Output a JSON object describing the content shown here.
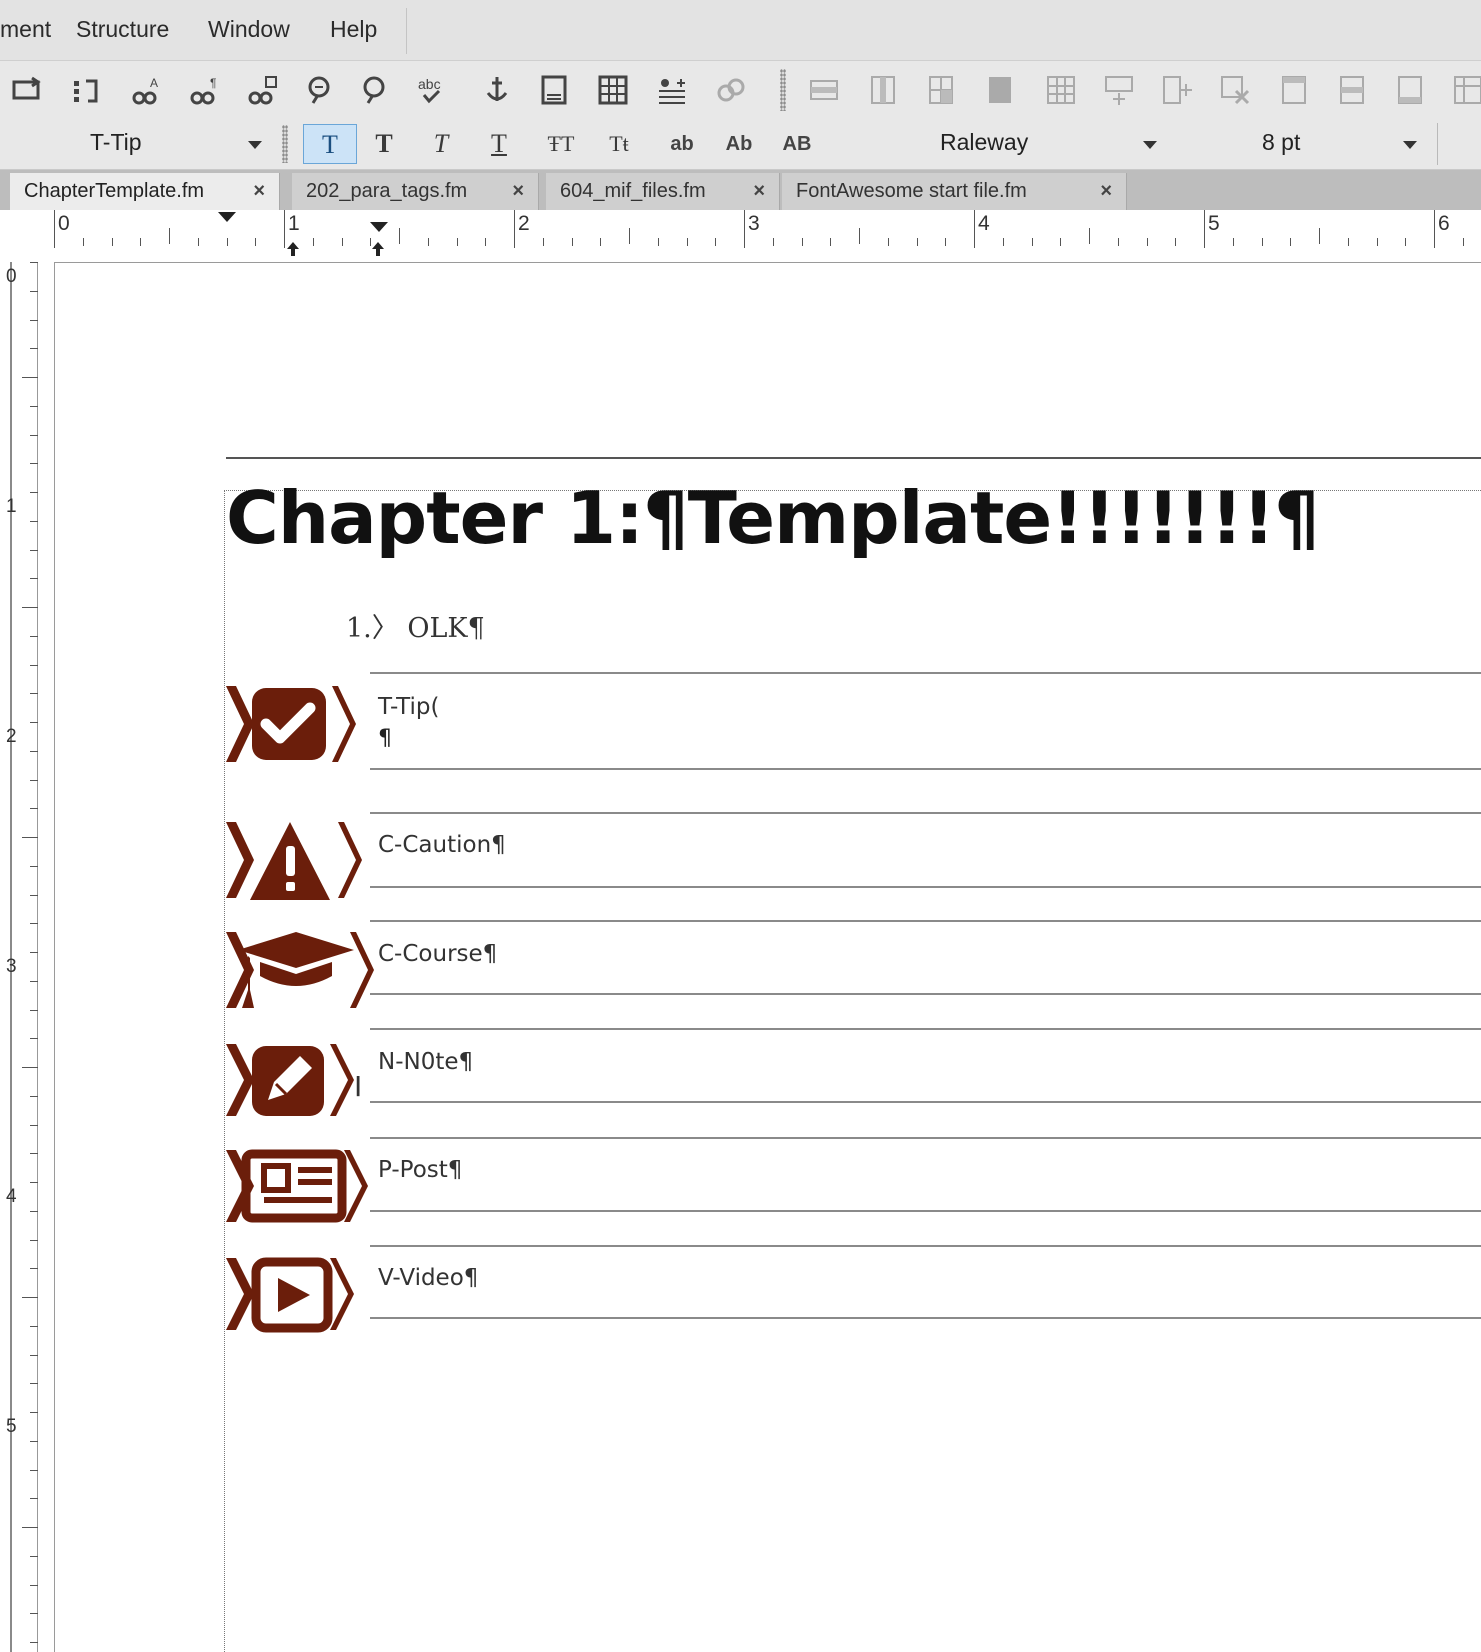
{
  "menu": {
    "items": [
      {
        "label": "ment"
      },
      {
        "label": "Structure"
      },
      {
        "label": "Window"
      },
      {
        "label": "Help"
      }
    ]
  },
  "format_toolbar": {
    "paragraph_tag": "T-Tip",
    "char_buttons": [
      "T",
      "T",
      "T",
      "T",
      "ŦT",
      "Tŧ",
      "ab",
      "Ab",
      "AB"
    ],
    "font_family": "Raleway",
    "font_size": "8 pt"
  },
  "tabs": [
    {
      "label": "ChapterTemplate.fm",
      "close": "×",
      "active": true
    },
    {
      "label": "202_para_tags.fm",
      "close": "×",
      "active": false
    },
    {
      "label": "604_mif_files.fm",
      "close": "×",
      "active": false
    },
    {
      "label": "FontAwesome start file.fm",
      "close": "×",
      "active": false
    }
  ],
  "ruler": {
    "h_numbers": [
      "0",
      "1",
      "2",
      "3",
      "4",
      "5",
      "6"
    ],
    "v_numbers": [
      "0",
      "1",
      "2",
      "3",
      "4",
      "5"
    ]
  },
  "document": {
    "heading": "Chapter 1:¶Template!!!!!!!¶",
    "olk": "1.〉 OLK¶",
    "cursor_line": "¶",
    "icon_color": "#6b1e0b",
    "callouts": [
      {
        "label": "T-Tip(",
        "icon": "check-square-icon"
      },
      {
        "label": "C-Caution¶",
        "icon": "warning-icon"
      },
      {
        "label": "C-Course¶",
        "icon": "graduation-cap-icon"
      },
      {
        "label": "N-N0te¶",
        "icon": "pencil-square-icon"
      },
      {
        "label": "P-Post¶",
        "icon": "newspaper-icon"
      },
      {
        "label": "V-Video¶",
        "icon": "play-square-icon"
      }
    ]
  }
}
